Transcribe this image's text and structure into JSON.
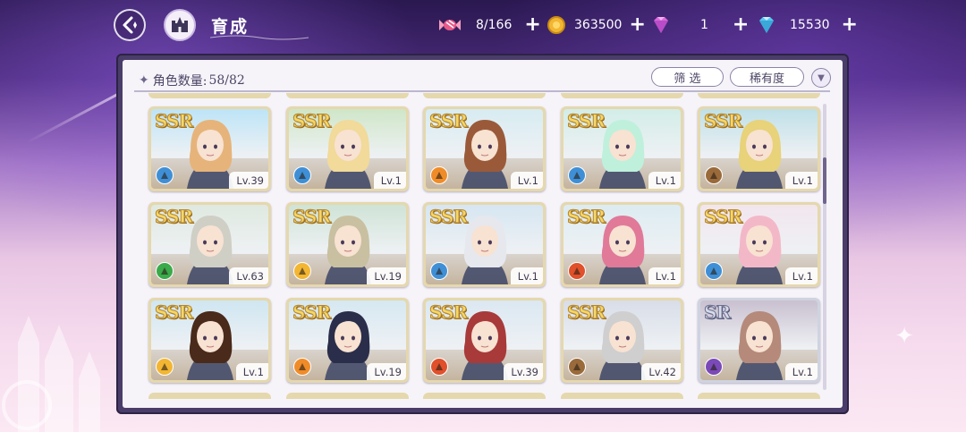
{
  "header": {
    "title": "育成",
    "resources": [
      {
        "name": "candy",
        "value": "8/166",
        "icon": "candy-icon",
        "color": "#e85a8a"
      },
      {
        "name": "coin",
        "value": "363500",
        "icon": "coin-icon",
        "color": "#f2b632"
      },
      {
        "name": "pink-gem",
        "value": "1",
        "icon": "pink-gem-icon",
        "color": "#d86ad8"
      },
      {
        "name": "blue-gem",
        "value": "15530",
        "icon": "blue-gem-icon",
        "color": "#5bc7ee"
      }
    ]
  },
  "panel": {
    "count_label": "角色数量:",
    "count_value": "58/82",
    "filter_label": "筛 选",
    "sort_label": "稀有度"
  },
  "cards": [
    {
      "rarity": "SSR",
      "level": "Lv.39",
      "attr_color": "#3f8fd6",
      "hair": "#e6b47a",
      "bg": "#bde4f7"
    },
    {
      "rarity": "SSR",
      "level": "Lv.1",
      "attr_color": "#3f8fd6",
      "hair": "#f1da9a",
      "bg": "#cfe6c8"
    },
    {
      "rarity": "SSR",
      "level": "Lv.1",
      "attr_color": "#f08c28",
      "hair": "#9a5a3a",
      "bg": "#d7ecf2"
    },
    {
      "rarity": "SSR",
      "level": "Lv.1",
      "attr_color": "#3f8fd6",
      "hair": "#bff0dc",
      "bg": "#d3ede8"
    },
    {
      "rarity": "SSR",
      "level": "Lv.1",
      "attr_color": "#9a6a3a",
      "hair": "#e8d27a",
      "bg": "#bfe0e8"
    },
    {
      "rarity": "SSR",
      "level": "Lv.63",
      "attr_color": "#3aaa4a",
      "hair": "#cfcfc6",
      "bg": "#dfe9e0"
    },
    {
      "rarity": "SSR",
      "level": "Lv.19",
      "attr_color": "#f2b632",
      "hair": "#c8c0a0",
      "bg": "#cfe3d6"
    },
    {
      "rarity": "SSR",
      "level": "Lv.1",
      "attr_color": "#3f8fd6",
      "hair": "#e6e8ee",
      "bg": "#d6e6f2"
    },
    {
      "rarity": "SSR",
      "level": "Lv.1",
      "attr_color": "#e0502a",
      "hair": "#e07a98",
      "bg": "#dcecf2"
    },
    {
      "rarity": "SSR",
      "level": "Lv.1",
      "attr_color": "#3f8fd6",
      "hair": "#f3b8c8",
      "bg": "#f2e6ee"
    },
    {
      "rarity": "SSR",
      "level": "Lv.1",
      "attr_color": "#f2b632",
      "hair": "#4a2a1a",
      "bg": "#cfe6f2"
    },
    {
      "rarity": "SSR",
      "level": "Lv.19",
      "attr_color": "#f08c28",
      "hair": "#2a2e4a",
      "bg": "#d6e8f2"
    },
    {
      "rarity": "SSR",
      "level": "Lv.39",
      "attr_color": "#e0502a",
      "hair": "#a83a3a",
      "bg": "#dbe8f2"
    },
    {
      "rarity": "SSR",
      "level": "Lv.42",
      "attr_color": "#9a6a3a",
      "hair": "#cfcfcf",
      "bg": "#d8dde8"
    },
    {
      "rarity": "SR",
      "level": "Lv.1",
      "attr_color": "#7a4ab8",
      "hair": "#b58a7a",
      "bg": "#c9c0d0"
    }
  ]
}
